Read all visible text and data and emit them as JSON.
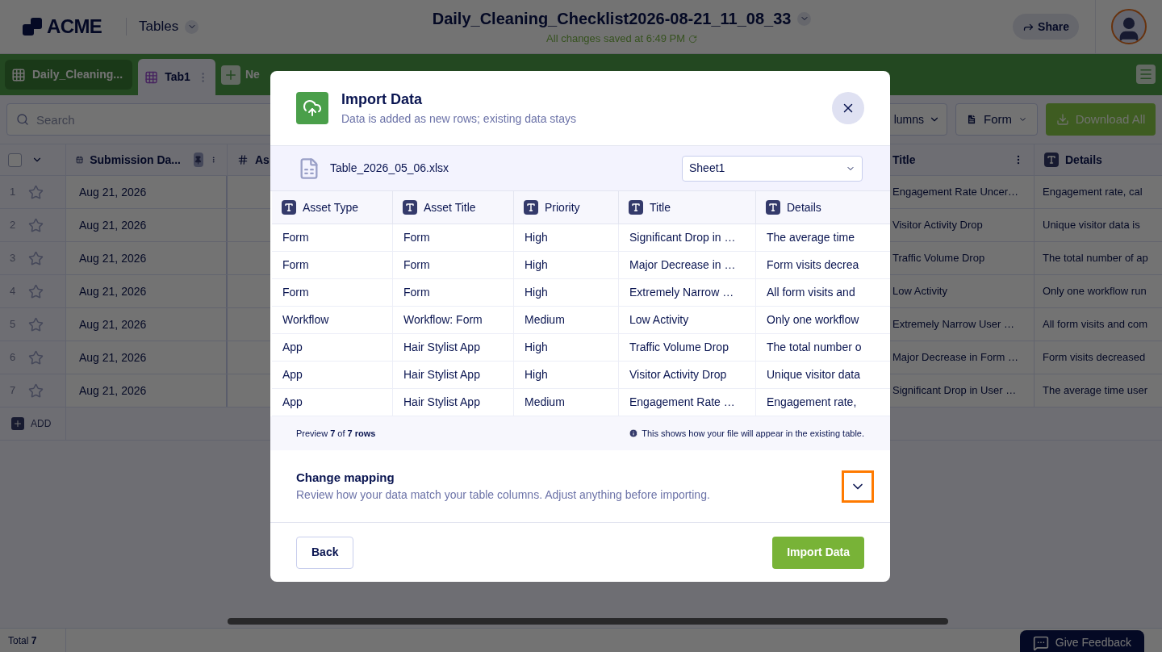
{
  "header": {
    "logo": "ACME",
    "app_menu": "Tables",
    "title": "Daily_Cleaning_Checklist2026-08-21_11_08_33",
    "save_status": "All changes saved at 6:49 PM",
    "share": "Share"
  },
  "tabs": [
    {
      "label": "Daily_Cleaning...",
      "selected": false
    },
    {
      "label": "Tab1",
      "selected": true
    }
  ],
  "new_tab": "Ne",
  "toolbar": {
    "search_placeholder": "Search",
    "columns": "lumns",
    "form": "Form",
    "download": "Download All"
  },
  "table": {
    "select_all_checked": false,
    "columns": [
      "Submission Da...",
      "As",
      "Title",
      "Details"
    ],
    "rows": [
      {
        "number": "1",
        "starred": false,
        "date": "Aug 21, 2026",
        "title": "Engagement Rate Uncer…",
        "details": "Engagement rate, cal"
      },
      {
        "number": "2",
        "starred": false,
        "date": "Aug 21, 2026",
        "title": "Visitor Activity Drop",
        "details": "Unique visitor data is"
      },
      {
        "number": "3",
        "starred": false,
        "date": "Aug 21, 2026",
        "title": "Traffic Volume Drop",
        "details": "The total number of ap"
      },
      {
        "number": "4",
        "starred": false,
        "date": "Aug 21, 2026",
        "title": "Low Activity",
        "details": "Only one workflow run"
      },
      {
        "number": "5",
        "starred": false,
        "date": "Aug 21, 2026",
        "title": "Extremely Narrow User …",
        "details": "All form visits and com"
      },
      {
        "number": "6",
        "starred": false,
        "date": "Aug 21, 2026",
        "title": "Major Decrease in Form …",
        "details": "Form visits decreased"
      },
      {
        "number": "7",
        "starred": false,
        "date": "Aug 21, 2026",
        "title": "Significant Drop in User …",
        "details": "The average time user"
      }
    ],
    "add": "ADD"
  },
  "status_bar": {
    "total": "Total **7**",
    "feedback": "Give Feedback"
  },
  "modal": {
    "title": "Import Data",
    "subtitle": "Data is added as new rows; existing data stays",
    "file_name": "Table_2026_05_06.xlsx",
    "sheet": "Sheet1",
    "columns": [
      "Asset Type",
      "Asset Title",
      "Priority",
      "Title",
      "Details"
    ],
    "rows": [
      [
        "Form",
        "Form",
        "High",
        "Significant Drop in …",
        "The average time"
      ],
      [
        "Form",
        "Form",
        "High",
        "Major Decrease in …",
        "Form visits decrea"
      ],
      [
        "Form",
        "Form",
        "High",
        "Extremely Narrow …",
        "All form visits and"
      ],
      [
        "Workflow",
        "Workflow: Form",
        "Medium",
        "Low Activity",
        "Only one workflow"
      ],
      [
        "App",
        "Hair Stylist App",
        "High",
        "Traffic Volume Drop",
        "The total number o"
      ],
      [
        "App",
        "Hair Stylist App",
        "High",
        "Visitor Activity Drop",
        "Unique visitor data"
      ],
      [
        "App",
        "Hair Stylist App",
        "Medium",
        "Engagement Rate …",
        "Engagement rate,"
      ]
    ],
    "preview": "Preview **7** of **7 rows**",
    "note": "This shows how your file will appear in the existing table.",
    "mapping": {
      "title": "Change mapping",
      "description": "Review how your data match your table columns. Adjust anything before importing.",
      "expanded": false,
      "focused": true
    },
    "back": "Back",
    "import": "Import Data"
  }
}
